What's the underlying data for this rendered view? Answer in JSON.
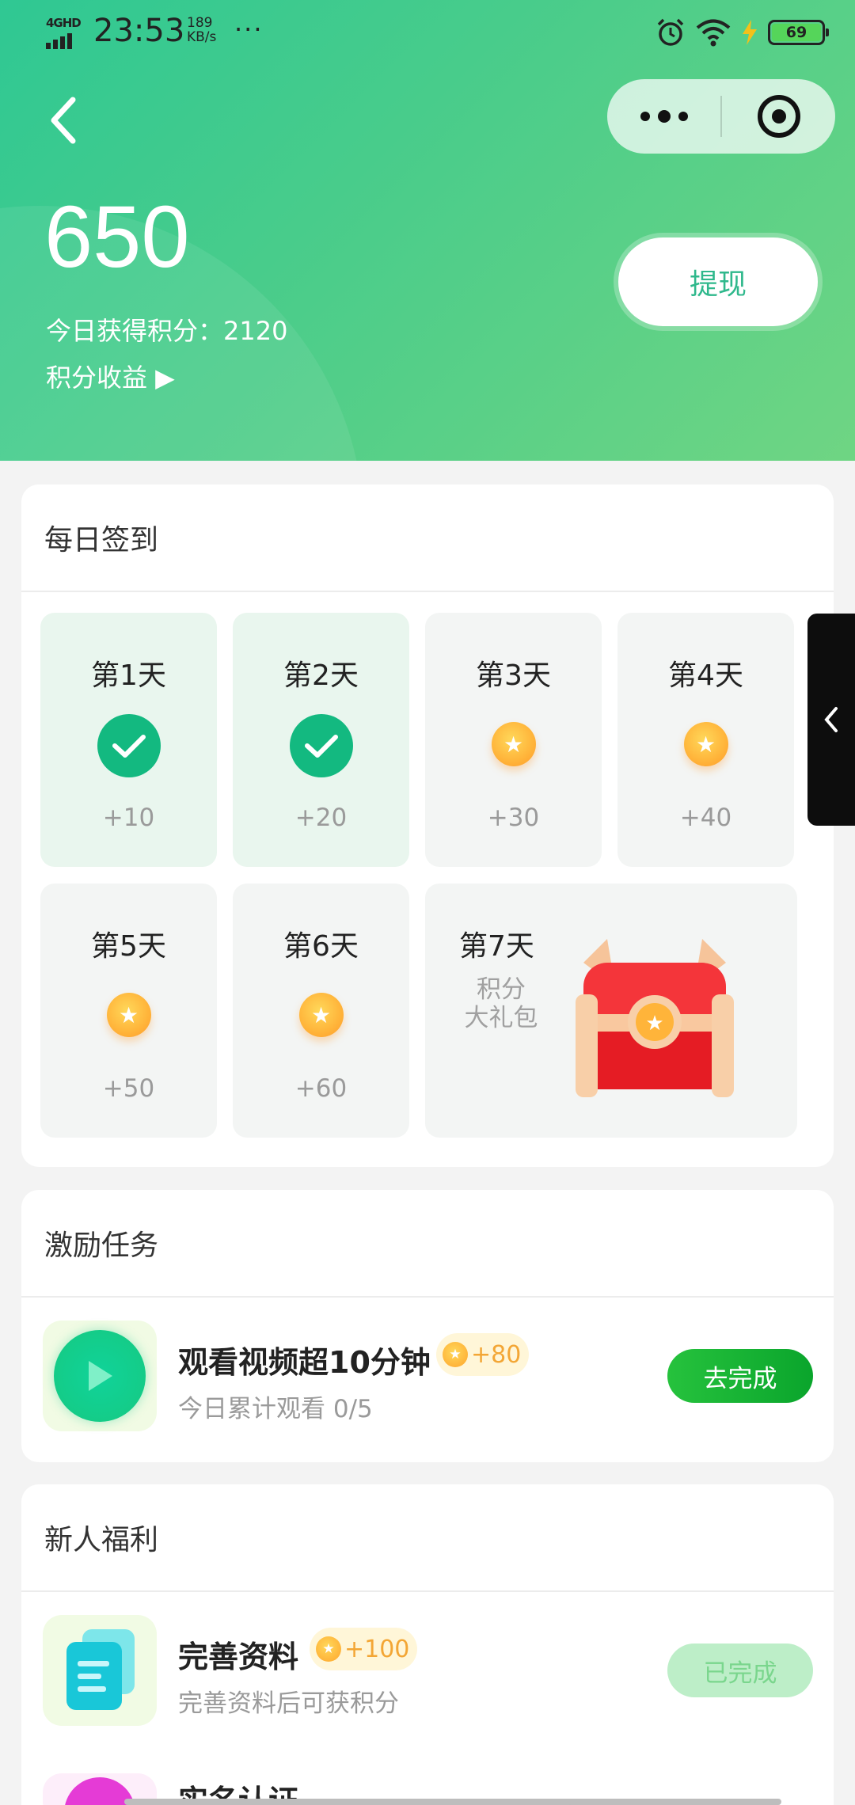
{
  "status_bar": {
    "network": "4GHD",
    "time": "23:53",
    "speed_value": "189",
    "speed_unit": "KB/s",
    "more": "···",
    "battery": "69"
  },
  "header": {
    "points": "650",
    "today_label": "今日获得积分：2120",
    "income_link": "积分收益 ▶",
    "withdraw_label": "提现"
  },
  "checkin": {
    "title": "每日签到",
    "days": [
      {
        "label": "第1天",
        "reward": "+10",
        "done": true
      },
      {
        "label": "第2天",
        "reward": "+20",
        "done": true
      },
      {
        "label": "第3天",
        "reward": "+30",
        "done": false
      },
      {
        "label": "第4天",
        "reward": "+40",
        "done": false
      },
      {
        "label": "第5天",
        "reward": "+50",
        "done": false
      },
      {
        "label": "第6天",
        "reward": "+60",
        "done": false
      }
    ],
    "day7": {
      "label": "第7天",
      "gift_line1": "积分",
      "gift_line2": "大礼包"
    }
  },
  "incentive": {
    "title": "激励任务",
    "task": {
      "title": "观看视频超10分钟",
      "points": "+80",
      "subtitle": "今日累计观看 0/5",
      "button": "去完成"
    }
  },
  "newbie": {
    "title": "新人福利",
    "task": {
      "title": "完善资料",
      "points": "+100",
      "subtitle": "完善资料后可获积分",
      "button": "已完成"
    },
    "next_task_partial": "实名认证"
  },
  "colors": {
    "header_green": "#48cc8b",
    "accent_green": "#13b980",
    "coin_gold": "#ffb43a",
    "button_green": "#0aa52c"
  }
}
